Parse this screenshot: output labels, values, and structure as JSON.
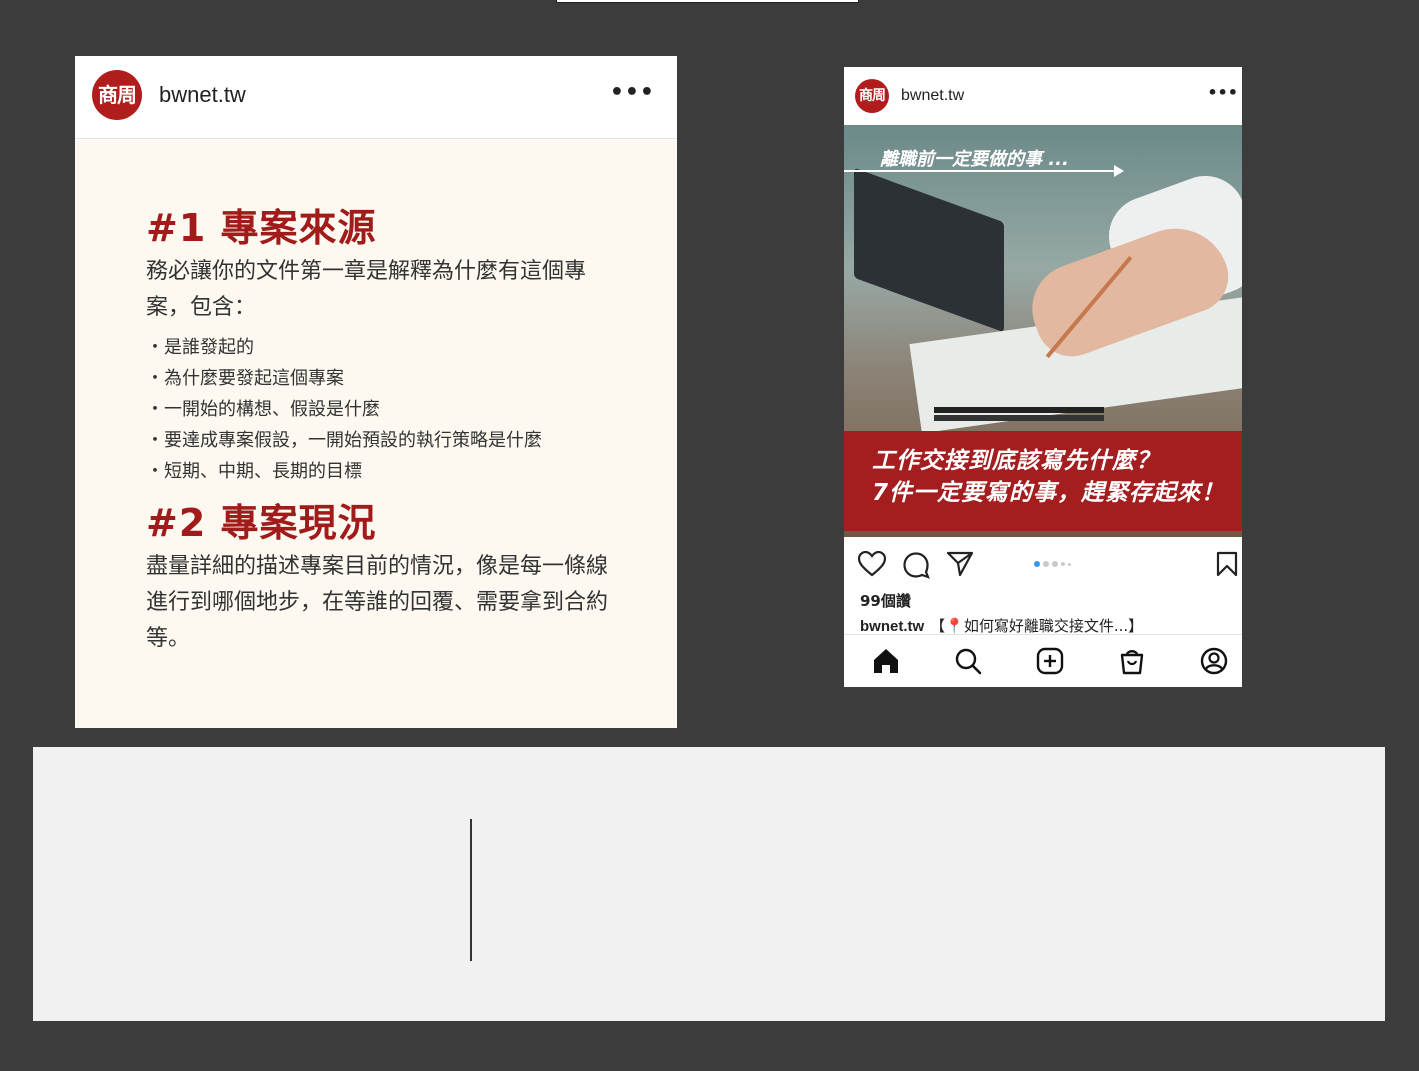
{
  "left_post": {
    "avatar_text": "商周",
    "username": "bwnet.tw",
    "more": "•••",
    "section1": {
      "title": "#1 專案來源",
      "text": "務必讓你的文件第一章是解釋為什麼有這個專案，包含：",
      "bullets": [
        "是誰發起的",
        "為什麼要發起這個專案",
        "一開始的構想、假設是什麼",
        "要達成專案假設，一開始預設的執行策略是什麼",
        "短期、中期、長期的目標"
      ]
    },
    "section2": {
      "title": "#2 專案現況",
      "text": "盡量詳細的描述專案目前的情況，像是每一條線進行到哪個地步，在等誰的回覆、需要拿到合約等。"
    }
  },
  "right_post": {
    "avatar_text": "商周",
    "username": "bwnet.tw",
    "more": "•••",
    "image_overlay": "離職前一定要做的事 ...",
    "banner_line1": "工作交接到底該寫先什麼？",
    "banner_line2": "7件一定要寫的事，趕緊存起來！",
    "likes": "99個讚",
    "caption_user": "bwnet.tw",
    "caption_text": "【📍如何寫好離職交接文件...】",
    "carousel_dots": 5,
    "carousel_active": 0,
    "icons": {
      "like": "heart-icon",
      "comment": "comment-icon",
      "share": "send-icon",
      "save": "bookmark-icon",
      "nav": [
        "home-icon",
        "search-icon",
        "add-post-icon",
        "shop-icon",
        "profile-icon"
      ]
    }
  },
  "colors": {
    "background": "#3c3c3c",
    "brand_red": "#a41d1f",
    "card_bg": "#fdf9f1",
    "panel_bg": "#f1f1f1",
    "carousel_active": "#3897f0"
  }
}
